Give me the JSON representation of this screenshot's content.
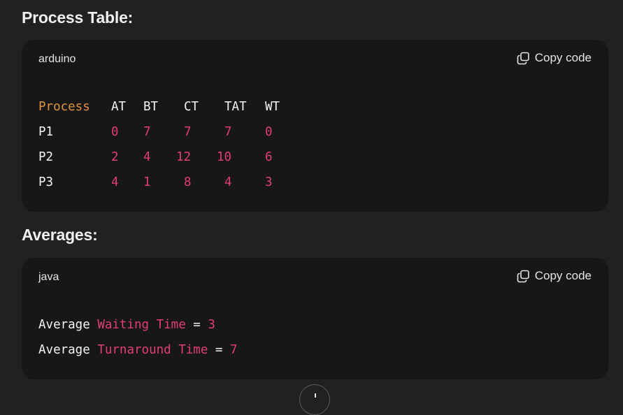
{
  "section1": {
    "heading": "Process Table:",
    "language": "arduino",
    "copy_label": "Copy code",
    "header": [
      "Process",
      "AT",
      "BT",
      "CT",
      "TAT",
      "WT"
    ],
    "rows": [
      [
        "P1",
        "0",
        "7",
        "7",
        "7",
        "0"
      ],
      [
        "P2",
        "2",
        "4",
        "12",
        "10",
        "6"
      ],
      [
        "P3",
        "4",
        "1",
        "8",
        "4",
        "3"
      ]
    ]
  },
  "section2": {
    "heading": "Averages:",
    "language": "java",
    "copy_label": "Copy code",
    "line1": {
      "word": "Average",
      "highlight": "Waiting Time",
      "op": "=",
      "value": "3"
    },
    "line2": {
      "word": "Average",
      "highlight": "Turnaround Time",
      "op": "=",
      "value": "7"
    }
  },
  "icons": {
    "copy": "copy-icon",
    "scroll": "scroll-down-icon"
  },
  "colors": {
    "background": "#212121",
    "code_background": "#171717",
    "keyword_orange": "#e2913c",
    "number_pink": "#e23d75"
  }
}
